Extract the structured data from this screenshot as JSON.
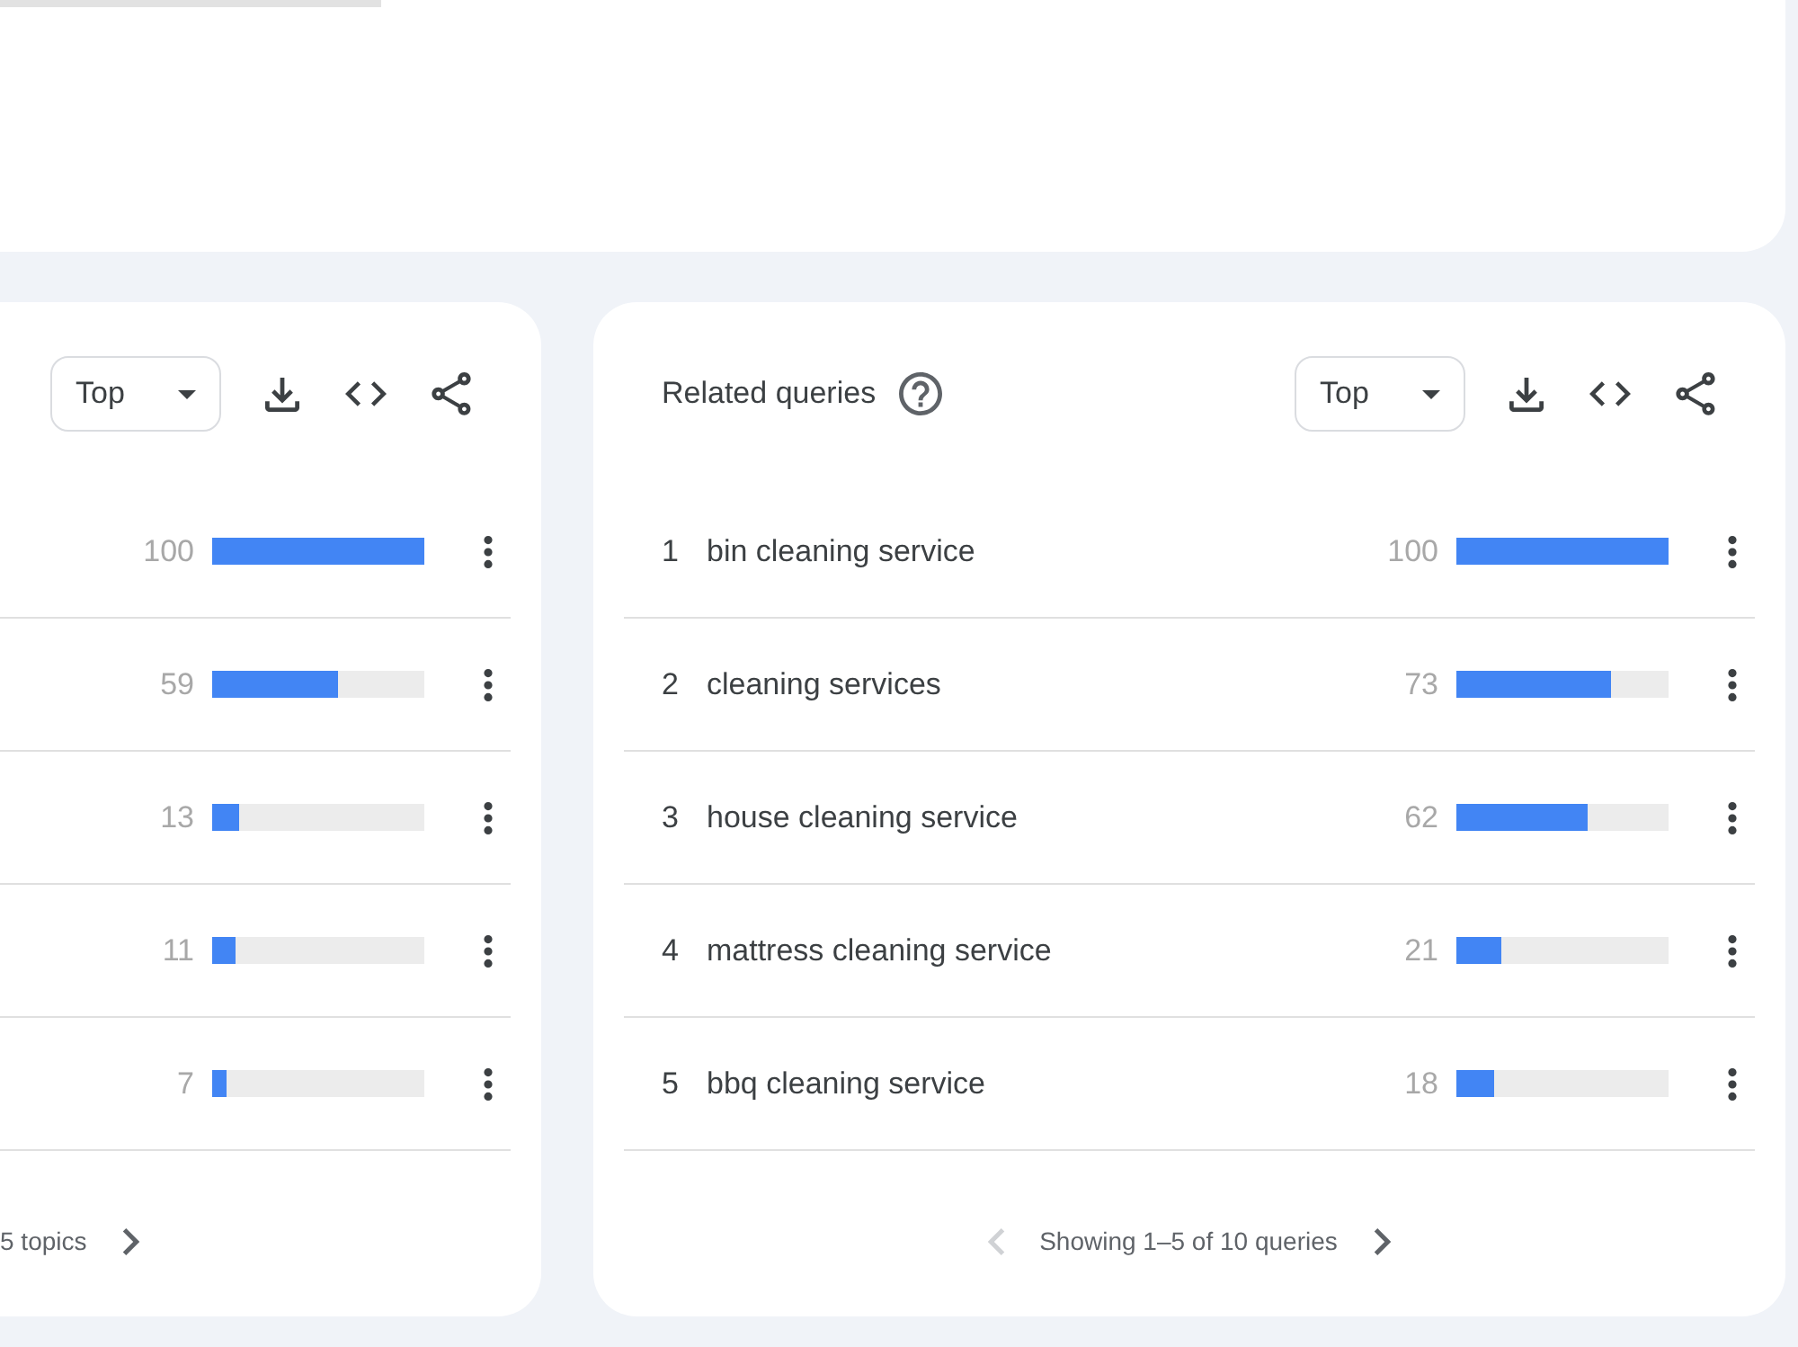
{
  "left_panel": {
    "sort_dropdown": {
      "value": "Top"
    },
    "rows": [
      {
        "value": "100",
        "level": 1
      },
      {
        "value": "59",
        "level": 0.59
      },
      {
        "value": "13",
        "level": 0.13
      },
      {
        "value": "11",
        "level": 0.11
      },
      {
        "value": "7",
        "level": 0.07
      }
    ],
    "footer": {
      "text": "5 topics",
      "next_disabled": false
    }
  },
  "related_queries": {
    "title": "Related queries",
    "sort_dropdown": {
      "value": "Top"
    },
    "rows": [
      {
        "rank": "1",
        "query": "bin cleaning service",
        "value": "100",
        "level": 1
      },
      {
        "rank": "2",
        "query": "cleaning services",
        "value": "73",
        "level": 0.73
      },
      {
        "rank": "3",
        "query": "house cleaning service",
        "value": "62",
        "level": 0.62
      },
      {
        "rank": "4",
        "query": "mattress cleaning service",
        "value": "21",
        "level": 0.21
      },
      {
        "rank": "5",
        "query": "bbq cleaning service",
        "value": "18",
        "level": 0.18
      }
    ],
    "footer": {
      "previous_disabled": true,
      "text": "Showing 1–5 of 10 queries",
      "next_disabled": false
    }
  }
}
